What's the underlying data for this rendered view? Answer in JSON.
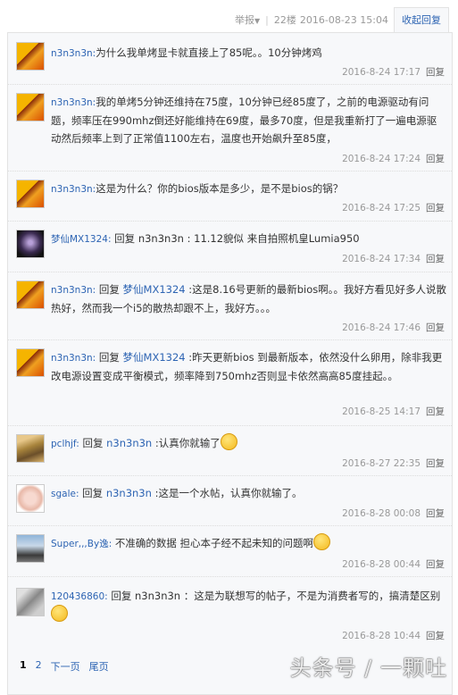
{
  "header": {
    "report_label": "举报",
    "floor": "22楼",
    "post_time": "2016-08-23 15:04",
    "collapse_label": "收起回复"
  },
  "replies": [
    {
      "user": "n3n3n3n:",
      "content": "为什么我单烤显卡就直接上了85呢。。10分钟烤鸡",
      "time": "2016-8-24 17:17",
      "reply_label": "回复"
    },
    {
      "user": "n3n3n3n:",
      "content": "我的单烤5分钟还维持在75度，10分钟已经85度了，之前的电源驱动有问题，频率压在990mhz倒还好能维持在69度，最多70度，但是我重新打了一遍电源驱动然后频率上到了正常值1100左右，温度也开始飙升至85度，",
      "time": "2016-8-24 17:24",
      "reply_label": "回复"
    },
    {
      "user": "n3n3n3n:",
      "content": "这是为什么？你的bios版本是多少，是不是bios的锅？",
      "time": "2016-8-24 17:25",
      "reply_label": "回复"
    },
    {
      "user": "梦仙MX1324:",
      "prefix": "回复",
      "target": "n3n3n3n",
      "content": "11.12貌似 来自拍照机皇Lumia950",
      "time": "2016-8-24 17:34",
      "reply_label": "回复"
    },
    {
      "user": "n3n3n3n:",
      "prefix": "回复",
      "target": "梦仙MX1324",
      "content": ":这是8.16号更新的最新bios啊。。我好方看见好多人说散热好，然而我一个i5的散热却跟不上，我好方。。。",
      "time": "2016-8-24 17:46",
      "reply_label": "回复"
    },
    {
      "user": "n3n3n3n:",
      "prefix": "回复",
      "target": "梦仙MX1324",
      "content": ":昨天更新bios 到最新版本，依然没什么卵用，除非我更改电源设置变成平衡模式，频率降到750mhz否则显卡依然高高85度挂起。。",
      "time": "2016-8-25 14:17",
      "reply_label": "回复"
    },
    {
      "user": "pclhjf:",
      "prefix": "回复",
      "target": "n3n3n3n",
      "content": ":认真你就输了",
      "time": "2016-8-27 22:35",
      "reply_label": "回复"
    },
    {
      "user": "sgale:",
      "prefix": "回复",
      "target": "n3n3n3n",
      "content": ":这是一个水帖，认真你就输了。",
      "time": "2016-8-28 00:08",
      "reply_label": "回复"
    },
    {
      "user": "Super,,,By逸:",
      "content": "不准确的数据 担心本子经不起未知的问题啊",
      "time": "2016-8-28 00:44",
      "reply_label": "回复"
    },
    {
      "user": "120436860:",
      "prefix": "回复",
      "target": "n3n3n3n",
      "content": "：这是为联想写的帖子，不是为消费者写的，搞清楚区别",
      "time": "2016-8-28 10:44",
      "reply_label": "回复"
    }
  ],
  "pagination": {
    "current": "1",
    "page2": "2",
    "next": "下一页",
    "last": "尾页"
  },
  "watermark": "头条号 / 一颗吐"
}
